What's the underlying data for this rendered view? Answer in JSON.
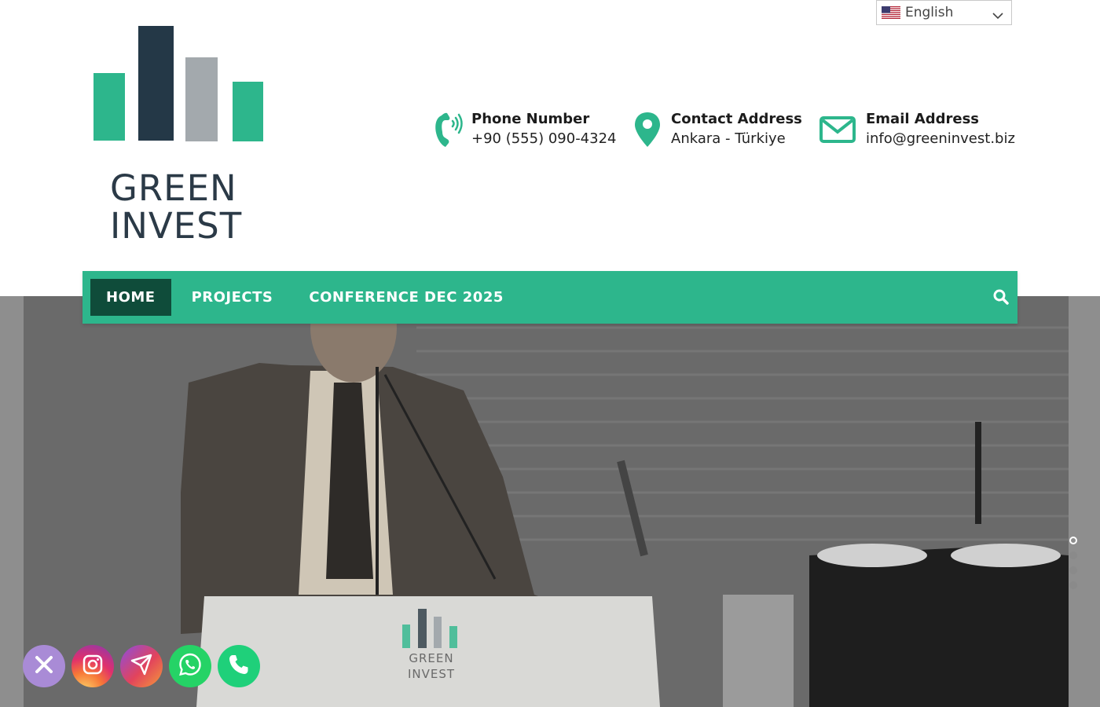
{
  "language": {
    "selected": "English"
  },
  "logo": {
    "line1": "GREEN",
    "line2": "INVEST"
  },
  "contacts": {
    "phone": {
      "label": "Phone Number",
      "value": "+90 (555) 090-4324"
    },
    "address": {
      "label": "Contact Address",
      "value": "Ankara - Türkiye"
    },
    "email": {
      "label": "Email Address",
      "value": "info@greeninvest.biz"
    }
  },
  "nav": {
    "items": [
      {
        "label": "HOME",
        "active": true
      },
      {
        "label": "PROJECTS",
        "active": false
      },
      {
        "label": "CONFERENCE DEC 2025",
        "active": false
      }
    ]
  },
  "hero": {
    "podium_logo_line1": "GREEN",
    "podium_logo_line2": "INVEST",
    "slide_count": 4,
    "active_slide": 1
  },
  "colors": {
    "brand_green": "#2db68c",
    "nav_active": "#0f4c3a",
    "logo_dark": "#2b3a47",
    "logo_gray": "#a3a9ad"
  },
  "social": [
    "close-icon",
    "instagram-icon",
    "telegram-icon",
    "whatsapp-icon",
    "phone-icon"
  ]
}
